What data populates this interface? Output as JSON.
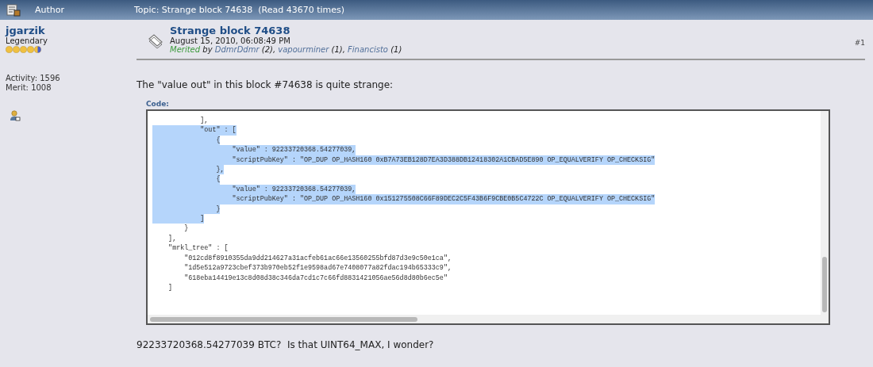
{
  "header": {
    "author_label": "Author",
    "topic": "Topic: Strange block 74638  (Read 43670 times)"
  },
  "author": {
    "name": "jgarzik",
    "rank": "Legendary",
    "stars": 4.5,
    "activity": "Activity: 1596",
    "merit": "Merit: 1008"
  },
  "post": {
    "title": "Strange block 74638",
    "date": "August 15, 2010, 06:08:49 PM",
    "merited_label": "Merited",
    "merited_by": "by",
    "merits": [
      {
        "user": "DdmrDdmr",
        "count": "(2),"
      },
      {
        "user": "vapourminer",
        "count": "(1),"
      },
      {
        "user": "Financisto",
        "count": "(1)"
      }
    ],
    "number": "#1",
    "intro": "The \"value out\" in this block #74638 is quite strange:",
    "code_label": "Code:",
    "code_lines": [
      {
        "text": "            ],",
        "selected": false
      },
      {
        "text": "            \"out\" : [",
        "selected": true
      },
      {
        "text": "                {",
        "selected": true
      },
      {
        "text": "                    \"value\" : 92233720368.54277039,",
        "selected": true
      },
      {
        "text": "                    \"scriptPubKey\" : \"OP_DUP OP_HASH160 0xB7A73EB128D7EA3D388DB12418302A1CBAD5E890 OP_EQUALVERIFY OP_CHECKSIG\"",
        "selected": true
      },
      {
        "text": "                },",
        "selected": true
      },
      {
        "text": "                {",
        "selected": true
      },
      {
        "text": "                    \"value\" : 92233720368.54277039,",
        "selected": true
      },
      {
        "text": "                    \"scriptPubKey\" : \"OP_DUP OP_HASH160 0x151275508C66F89DEC2C5F43B6F9CBE0B5C4722C OP_EQUALVERIFY OP_CHECKSIG\"",
        "selected": true
      },
      {
        "text": "                }",
        "selected": true
      },
      {
        "text": "            ]",
        "selected": true
      },
      {
        "text": "        }",
        "selected": false
      },
      {
        "text": "    ],",
        "selected": false
      },
      {
        "text": "    \"mrkl_tree\" : [",
        "selected": false
      },
      {
        "text": "        \"012cd8f8910355da9dd214627a31acfeb61ac66e13560255bfd87d3e9c50e1ca\",",
        "selected": false
      },
      {
        "text": "        \"1d5e512a9723cbef373b970eb52f1e9598ad67e7408077a82fdac194b65333c9\",",
        "selected": false
      },
      {
        "text": "        \"618eba14419e13c8d08d38c346da7cd1c7c66fd8831421056ae56d8d80b6ec5e\"",
        "selected": false
      },
      {
        "text": "    ]",
        "selected": false
      }
    ],
    "outro": "92233720368.54277039 BTC?  Is that UINT64_MAX, I wonder?"
  }
}
